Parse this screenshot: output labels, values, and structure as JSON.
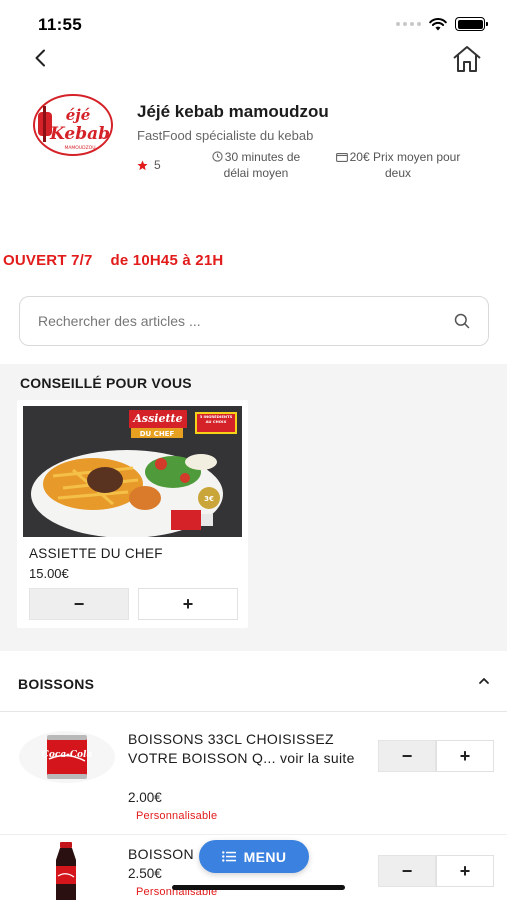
{
  "status_bar": {
    "time": "11:55"
  },
  "restaurant": {
    "logo_text_top": "éjé",
    "logo_text_bottom": "Kebab",
    "logo_tagline": "MAMOUDZOU",
    "name": "Jéjé kebab mamoudzou",
    "subtitle": "FastFood spécialiste du kebab",
    "rating": "5",
    "delivery_time_line1": "30 minutes de",
    "delivery_time_line2": "délai moyen",
    "price_line1": "20€ Prix moyen pour",
    "price_line2": "deux"
  },
  "hours": {
    "open": "OUVERT 7/7",
    "time": "de 10H45 à 21H"
  },
  "search": {
    "placeholder": "Rechercher des articles ..."
  },
  "recommended": {
    "title": "CONSEILLÉ POUR VOUS",
    "items": [
      {
        "name": "ASSIETTE DU CHEF",
        "price": "15.00€",
        "image_banner_1": "Assiette",
        "image_banner_2": "DU CHEF",
        "image_badge": "3 INGRÉDIENTS AU CHOIX",
        "image_tag": "3€"
      }
    ],
    "minus": "−",
    "plus": "+"
  },
  "category": {
    "title": "BOISSONS",
    "products": [
      {
        "name": "BOISSONS 33CL CHOISISSEZ VOTRE BOISSON Q... voir la suite",
        "price": "2.00€",
        "badge": "Personnalisable",
        "image_label": "Coca-Cola"
      },
      {
        "name": "BOISSON",
        "price": "2.50€",
        "badge": "Personnalisable"
      }
    ],
    "minus": "−",
    "plus": "+"
  },
  "fab": {
    "label": "MENU"
  },
  "colors": {
    "accent_red": "#e21b1b",
    "fab_blue": "#3b82e0"
  }
}
